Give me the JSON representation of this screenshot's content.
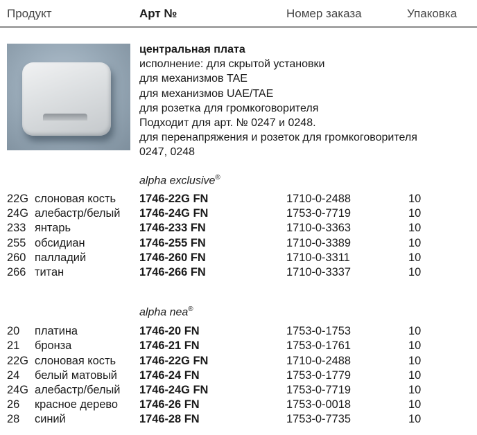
{
  "header": {
    "product": "Продукт",
    "art": "Арт №",
    "order": "Номер заказа",
    "pack": "Упаковка"
  },
  "description": {
    "title": "центральная плата",
    "lines": [
      "исполнение: для скрытой установки",
      "для механизмов TAE",
      "для механизмов UAE/TAE",
      "для розетка для громкоговорителя",
      "Подходит для арт. № 0247 и 0248.",
      "для перенапряжения и розеток для громкоговорителя",
      "0247, 0248"
    ]
  },
  "sections": [
    {
      "title": "alpha exclusive",
      "mark": "®",
      "rows": [
        {
          "code": "22G",
          "name": "слоновая кость",
          "art": "1746-22G FN",
          "order": "1710-0-2488",
          "pack": "10"
        },
        {
          "code": "24G",
          "name": "алебастр/белый",
          "art": "1746-24G FN",
          "order": "1753-0-7719",
          "pack": "10"
        },
        {
          "code": "233",
          "name": "янтарь",
          "art": "1746-233 FN",
          "order": "1710-0-3363",
          "pack": "10"
        },
        {
          "code": "255",
          "name": "обсидиан",
          "art": "1746-255 FN",
          "order": "1710-0-3389",
          "pack": "10"
        },
        {
          "code": "260",
          "name": "палладий",
          "art": "1746-260 FN",
          "order": "1710-0-3311",
          "pack": "10"
        },
        {
          "code": "266",
          "name": "титан",
          "art": "1746-266 FN",
          "order": "1710-0-3337",
          "pack": "10"
        }
      ]
    },
    {
      "title": "alpha nea",
      "mark": "®",
      "rows": [
        {
          "code": "20",
          "name": "платина",
          "art": "1746-20 FN",
          "order": "1753-0-1753",
          "pack": "10"
        },
        {
          "code": "21",
          "name": "бронза",
          "art": "1746-21 FN",
          "order": "1753-0-1761",
          "pack": "10"
        },
        {
          "code": "22G",
          "name": "слоновая кость",
          "art": "1746-22G FN",
          "order": "1710-0-2488",
          "pack": "10"
        },
        {
          "code": "24",
          "name": "белый матовый",
          "art": "1746-24 FN",
          "order": "1753-0-1779",
          "pack": "10"
        },
        {
          "code": "24G",
          "name": "алебастр/белый",
          "art": "1746-24G FN",
          "order": "1753-0-7719",
          "pack": "10"
        },
        {
          "code": "26",
          "name": "красное дерево",
          "art": "1746-26 FN",
          "order": "1753-0-0018",
          "pack": "10"
        },
        {
          "code": "28",
          "name": "синий",
          "art": "1746-28 FN",
          "order": "1753-0-7735",
          "pack": "10"
        }
      ]
    }
  ]
}
